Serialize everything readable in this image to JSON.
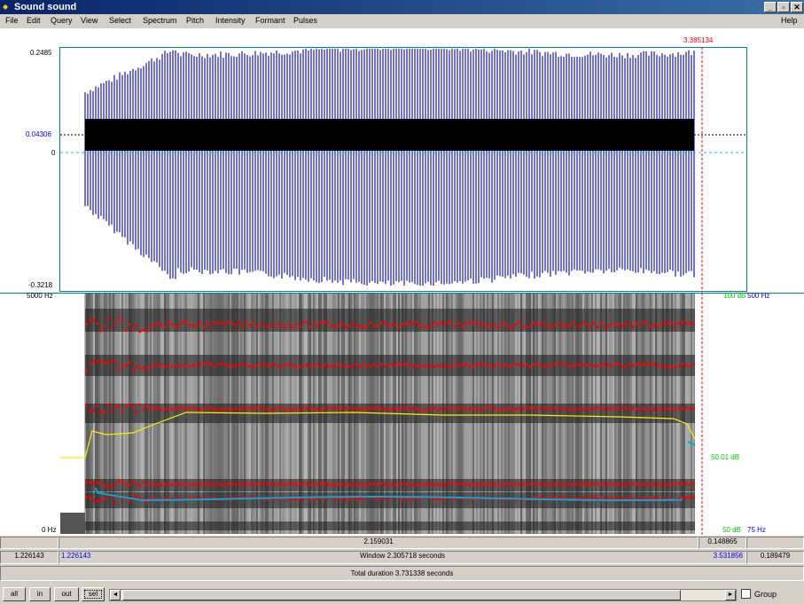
{
  "window": {
    "title": "Sound sound",
    "controls": {
      "minimize": "_",
      "maximize": "▫",
      "close": "✕"
    }
  },
  "menu": {
    "items": [
      "File",
      "Edit",
      "Query",
      "View",
      "Select",
      "Spectrum",
      "Pitch",
      "Intensity",
      "Formant",
      "Pulses"
    ],
    "help": "Help"
  },
  "waveform": {
    "y_max": "0.2485",
    "y_cursor": "0.04306",
    "y_zero": "0",
    "y_min": "-0.3218",
    "cursor_time": "3.385134"
  },
  "spectrogram": {
    "freq_max": "5000 Hz",
    "freq_min": "0 Hz",
    "right_top_green": "100 dB",
    "right_top_blue": "500 Hz",
    "right_mid_green": "50.01 dB",
    "right_bottom_green": "50 dB",
    "right_bottom_blue": "75 Hz"
  },
  "time_bars": {
    "selection_duration": "2.159031",
    "right_segment": "0.148865",
    "left_time": "1.226143",
    "window_start": "1.226143",
    "window_label": "Window 2.305718 seconds",
    "window_end": "3.531856",
    "right_time": "0.189479",
    "total_label": "Total duration 3.731338 seconds"
  },
  "buttons": {
    "all": "all",
    "in": "in",
    "out": "out",
    "sel": "sel"
  },
  "scrollbar": {
    "left_arrow": "◄",
    "right_arrow": "►"
  },
  "group": {
    "label": "Group",
    "checked": false
  },
  "colors": {
    "wave_blue": "#0000aa",
    "cursor_red": "#ff0000",
    "formant_red": "#ff0000",
    "pitch_blue": "#00aadd",
    "intensity_yellow": "#ffee00",
    "dB_green": "#00cc00",
    "axis_blue": "#0000ff",
    "frame_teal": "#008888"
  }
}
